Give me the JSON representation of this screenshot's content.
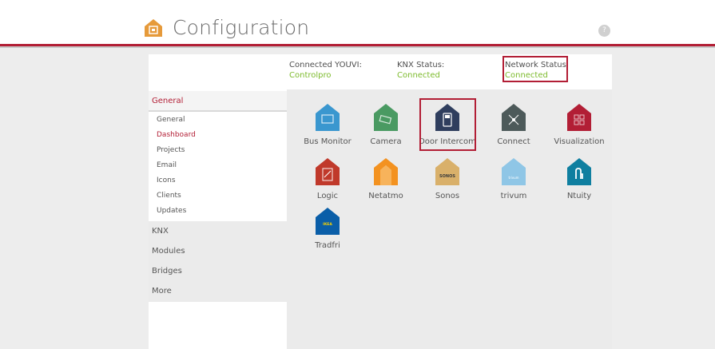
{
  "header": {
    "title": "Configuration",
    "help_label": "?"
  },
  "status": {
    "youvi_label": "Connected YOUVI:",
    "youvi_value": "Controlpro",
    "knx_label": "KNX Status:",
    "knx_value": "Connected",
    "network_label": "Network Status:",
    "network_value": "Connected"
  },
  "sidebar": {
    "general": "General",
    "items": [
      "General",
      "Dashboard",
      "Projects",
      "Email",
      "Icons",
      "Clients",
      "Updates"
    ],
    "selected": "Dashboard",
    "knx": "KNX",
    "modules": "Modules",
    "bridges": "Bridges",
    "more": "More"
  },
  "modules": [
    {
      "label": "Bus Monitor",
      "color": "#3a97cf",
      "icon": "monitor-icon"
    },
    {
      "label": "Camera",
      "color": "#4a9a62",
      "icon": "camera-icon"
    },
    {
      "label": "Door Intercom",
      "color": "#2f3e5e",
      "icon": "intercom-icon"
    },
    {
      "label": "Connect",
      "color": "#4d5a5a",
      "icon": "network-icon"
    },
    {
      "label": "Visualization",
      "color": "#b21e35",
      "icon": "grid-icon"
    },
    {
      "label": "Logic",
      "color": "#c0392b",
      "icon": "logic-icon"
    },
    {
      "label": "Netatmo",
      "color": "#f39220",
      "icon": "netatmo-icon"
    },
    {
      "label": "Sonos",
      "color": "#d9b06a",
      "icon": "sonos-icon",
      "badge": "SONOS"
    },
    {
      "label": "trivum",
      "color": "#8fc6e6",
      "icon": "trivum-icon",
      "badge": "trivum"
    },
    {
      "label": "Ntuity",
      "color": "#0f7fa0",
      "icon": "ntuity-icon"
    },
    {
      "label": "Tradfri",
      "color": "#0a5ea8",
      "icon": "ikea-icon",
      "badge": "IKEA"
    }
  ]
}
